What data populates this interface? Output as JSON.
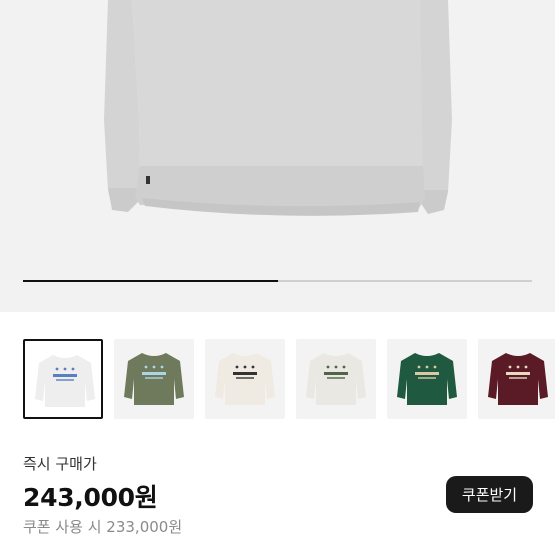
{
  "product": {
    "image_alt": "Gray crewneck sweatshirt",
    "gallery_progress": 0.5
  },
  "thumbnails": [
    {
      "name": "gray",
      "body": "#eeeeee",
      "accent": "#5a7fc0",
      "selected": true
    },
    {
      "name": "khaki",
      "body": "#6f7a5c",
      "accent": "#a9d5e6",
      "selected": false
    },
    {
      "name": "ivory-black",
      "body": "#efeae2",
      "accent": "#333333",
      "selected": false
    },
    {
      "name": "oatmeal",
      "body": "#e9e8e2",
      "accent": "#51644a",
      "selected": false
    },
    {
      "name": "green",
      "body": "#1f5a40",
      "accent": "#d9c7a6",
      "selected": false
    },
    {
      "name": "burgundy",
      "body": "#5a1a26",
      "accent": "#e8dac0",
      "selected": false
    }
  ],
  "purchase": {
    "label": "즉시 구매가",
    "price": "243,000원",
    "coupon_note": "쿠폰 사용 시 233,000원",
    "coupon_button": "쿠폰받기"
  }
}
